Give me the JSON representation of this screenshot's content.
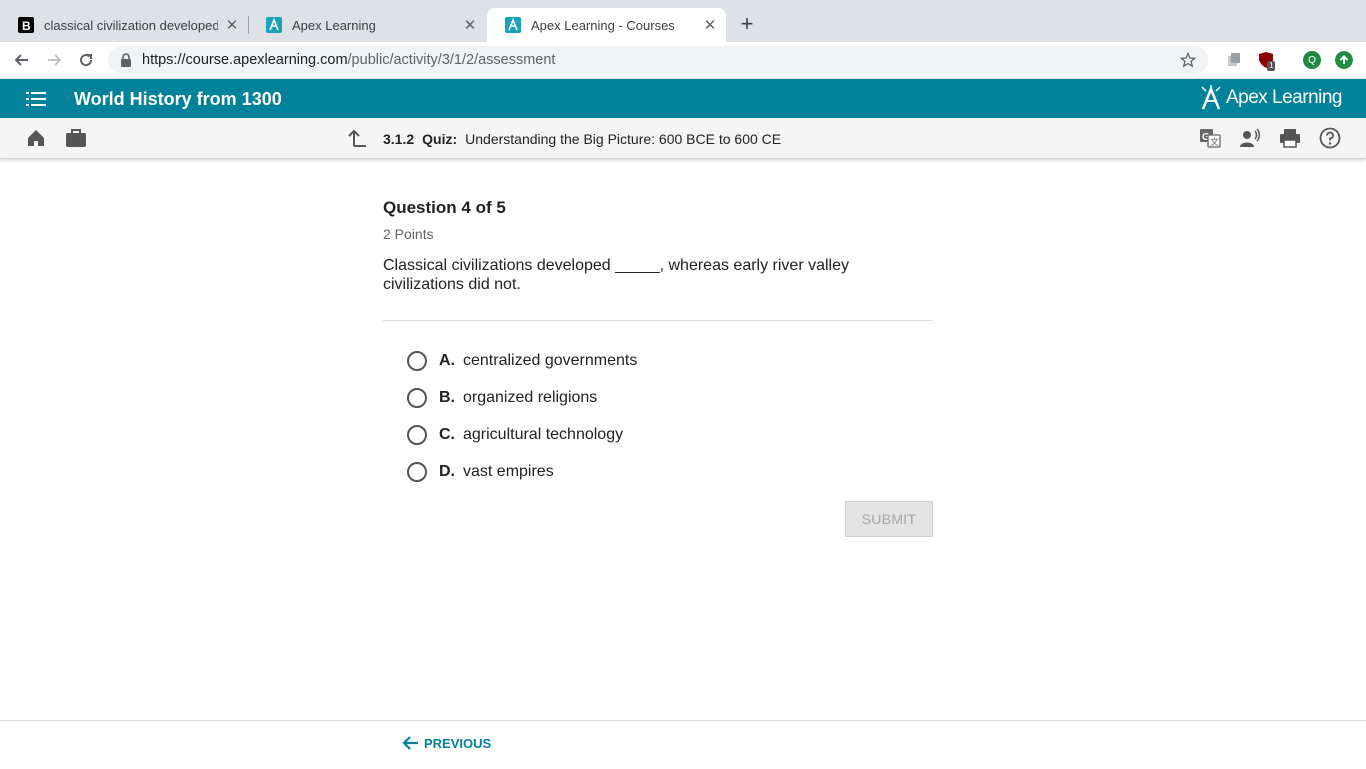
{
  "browser": {
    "tabs": [
      {
        "title": "classical civilization developed",
        "favicon": "brainly-favicon",
        "active": false
      },
      {
        "title": "Apex Learning",
        "favicon": "apex-favicon",
        "active": false
      },
      {
        "title": "Apex Learning - Courses",
        "favicon": "apex-favicon",
        "active": true
      }
    ],
    "url_host": "https://course.apexlearning.com",
    "url_path": "/public/activity/3/1/2/assessment",
    "profile_initial": "Q",
    "extension_badge": "1"
  },
  "app": {
    "course_title": "World History from 1300",
    "brand": "Apex Learning",
    "brand_color": "#00829b"
  },
  "breadcrumb": {
    "number": "3.1.2",
    "type": "Quiz:",
    "title": "Understanding the Big Picture: 600 BCE to 600 CE"
  },
  "question": {
    "heading": "Question 4 of 5",
    "points": "2 Points",
    "text": "Classical civilizations developed _____, whereas early river valley civilizations did not.",
    "options": [
      {
        "letter": "A.",
        "text": "centralized governments"
      },
      {
        "letter": "B.",
        "text": "organized religions"
      },
      {
        "letter": "C.",
        "text": "agricultural technology"
      },
      {
        "letter": "D.",
        "text": "vast empires"
      }
    ],
    "submit_label": "SUBMIT"
  },
  "footer": {
    "previous_label": "PREVIOUS"
  }
}
